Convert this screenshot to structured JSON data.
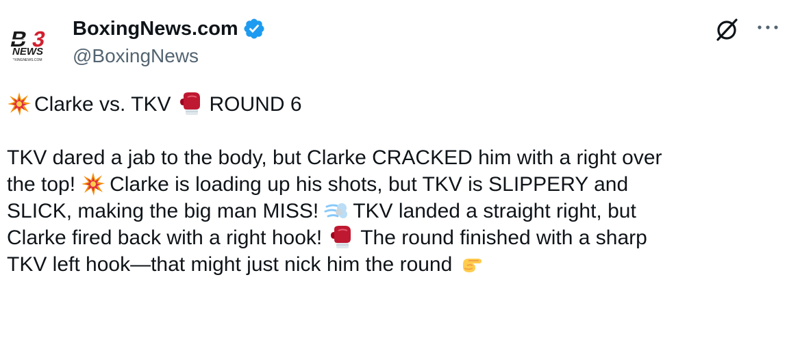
{
  "author": {
    "display_name": "BoxingNews.com",
    "handle": "@BoxingNews",
    "verified": true,
    "avatar_logo": {
      "mark": "B3",
      "word": "NEWS",
      "small": "BOXINGNEWS.COM"
    }
  },
  "icons": {
    "verified": "verified-badge-icon",
    "grok": "grok-icon",
    "more": "more-options-icon",
    "colors": {
      "verified_blue": "#1d9bf0",
      "text": "#0f1419",
      "secondary": "#536471"
    }
  },
  "tweet": {
    "headline": {
      "emoji_1": "collision-emoji",
      "text_1": "Clarke vs. TKV",
      "emoji_2": "boxing-glove-emoji",
      "text_2": "ROUND 6"
    },
    "lines": {
      "l1": "TKV dared a jab to the body, but Clarke CRACKED him with a right over",
      "l2a": "the top!",
      "l2b": "Clarke is loading up his shots, but TKV is SLIPPERY and",
      "l3a": "SLICK, making the big man MISS!",
      "l3b": "TKV landed a straight right, but",
      "l4a": "Clarke fired back with a right hook!",
      "l4b": "The round finished with a sharp",
      "l5": "TKV left hook—that might just nick him the round"
    }
  }
}
